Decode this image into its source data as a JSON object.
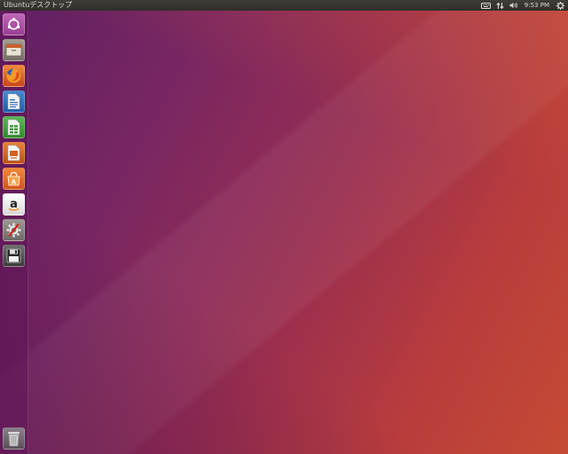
{
  "top_panel": {
    "app_title": "Ubuntuデスクトップ",
    "clock": "9:53 PM",
    "indicators": [
      "keyboard-icon",
      "network-icon",
      "volume-icon",
      "gear-icon"
    ]
  },
  "launcher": {
    "items": [
      {
        "icon": "ubuntu-logo-icon",
        "color": "#b04fa8"
      },
      {
        "icon": "files-icon",
        "color": "#8a8478"
      },
      {
        "icon": "firefox-icon",
        "color": "#e0642a"
      },
      {
        "icon": "writer-icon",
        "color": "#2a6ab8"
      },
      {
        "icon": "calc-icon",
        "color": "#3f9a3a"
      },
      {
        "icon": "impress-icon",
        "color": "#d2601f"
      },
      {
        "icon": "software-center-icon",
        "color": "#e8732a"
      },
      {
        "icon": "amazon-icon",
        "color": "#f2f2f2"
      },
      {
        "icon": "settings-icon",
        "color": "#8f8b86"
      },
      {
        "icon": "save-disk-icon",
        "color": "#5a5a5a"
      }
    ],
    "trash": {
      "icon": "trash-icon"
    }
  },
  "colors": {
    "panel": "#3f3e39",
    "panel_text": "#dfdbd2",
    "wallpaper_left": "#5e1f63",
    "wallpaper_right": "#c64a33"
  }
}
